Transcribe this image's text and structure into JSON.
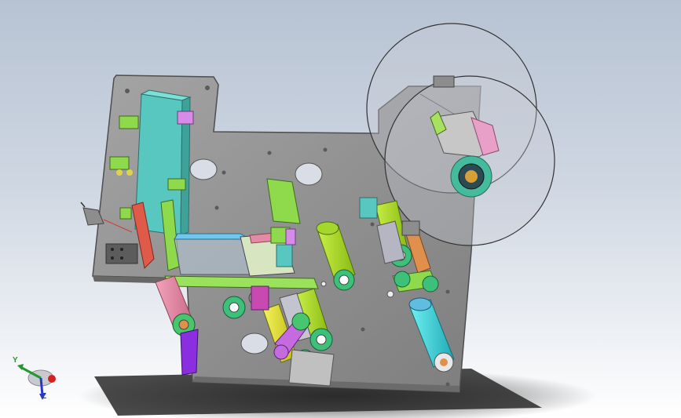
{
  "viewport": {
    "title": "",
    "background_top": "#b7c3d3",
    "background_bottom": "#ffffff"
  },
  "model": {
    "description_colors": {
      "plate": "#8f8f8f",
      "plate_edge": "#5d5d5d",
      "cyan_part": "#4fc7c0",
      "green_part": "#8ed94c",
      "lime_roller": "#a9d81f",
      "pink_roller": "#e58aa5",
      "purple_part": "#9b42c8",
      "red_block": "#e05a4a",
      "orange_roller": "#e0904c",
      "cyan_roller": "#39d0d8",
      "yellow_roller": "#e3e025"
    }
  },
  "triad": {
    "y_label": "Y",
    "z_label": "Z",
    "x_color": "#d42020",
    "y_color": "#1f9a2e",
    "z_color": "#2638c8"
  }
}
